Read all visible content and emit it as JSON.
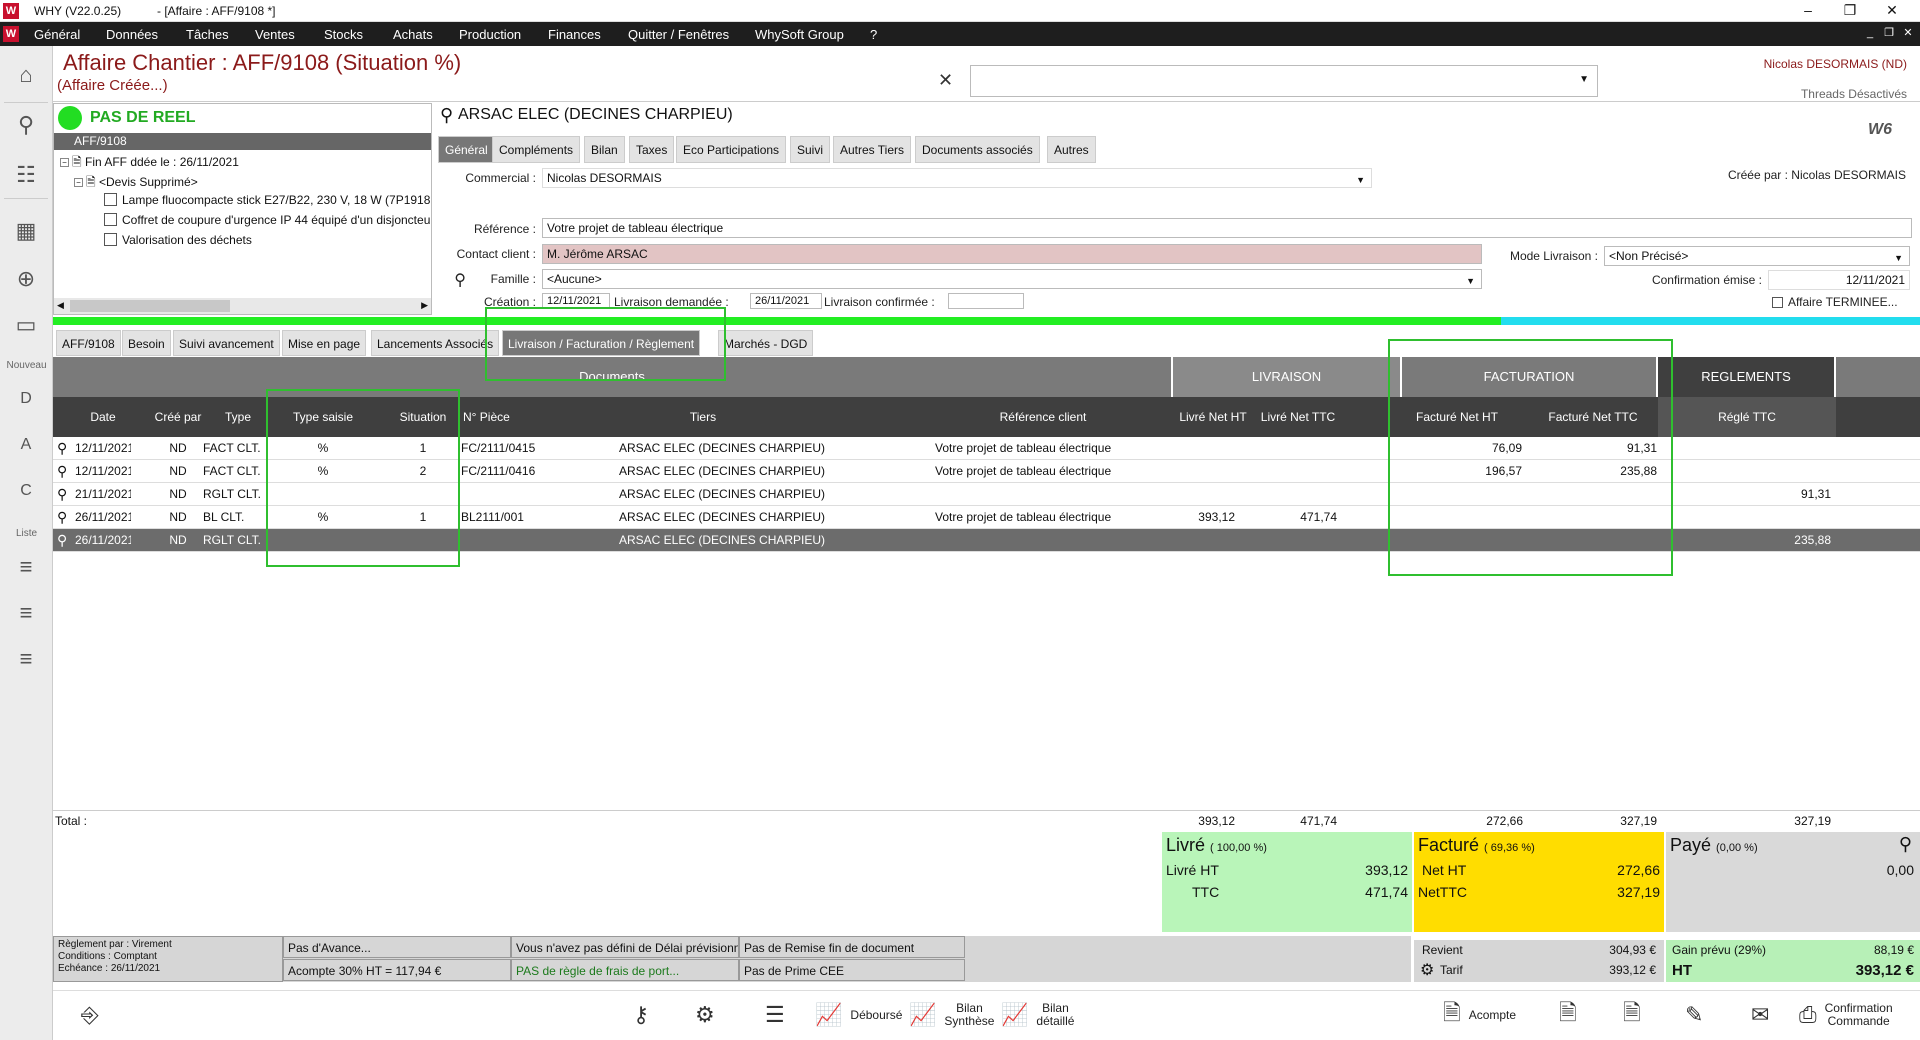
{
  "window": {
    "app_title": "WHY (V22.0.25)",
    "doc_title": "- [Affaire : AFF/9108 *]",
    "logo": "W",
    "min": "–",
    "restore": "❐",
    "close": "✕"
  },
  "menu": {
    "items": [
      "Général",
      "Données",
      "Tâches",
      "Ventes",
      "Stocks",
      "Achats",
      "Production",
      "Finances",
      "Quitter / Fenêtres",
      "WhySoft Group",
      "?"
    ],
    "mdi": [
      "_",
      "❐",
      "✕"
    ]
  },
  "leftbar": {
    "nouveau": "Nouveau",
    "liste": "Liste",
    "icons": [
      "home-icon",
      "search-icon",
      "clipboard-icon",
      "calculator-icon",
      "web-icon",
      "folder-icon",
      "new-devis-icon",
      "new-affaire-icon",
      "new-commande-icon",
      "list-d-icon",
      "list-a-icon",
      "list-c-icon"
    ],
    "glyphs": [
      "⌂",
      "⚲",
      "☷",
      "▦",
      "⊕",
      "▭",
      "D",
      "A",
      "C",
      "≡",
      "≡",
      "≡"
    ]
  },
  "header": {
    "title": "Affaire Chantier : AFF/9108 (Situation %)",
    "subtitle": "(Affaire Créée...)",
    "close": "✕",
    "user": "Nicolas DESORMAIS (ND)",
    "threads": "Threads Désactivés"
  },
  "tree": {
    "status": "PAS DE REEL",
    "root": "AFF/9108",
    "node1": "Fin AFF ddée le : 26/11/2021",
    "node2": "<Devis Supprimé>",
    "items": [
      "Lampe fluocompacte stick E27/B22, 230 V, 18 W (7P1918",
      "Coffret de coupure d'urgence IP 44 équipé d'un disjoncteu",
      "Valorisation des déchets"
    ]
  },
  "fiche": {
    "client": "ARSAC ELEC  (DECINES CHARPIEU)",
    "logo": "W6",
    "tabs": [
      "Général",
      "Compléments",
      "Bilan",
      "Taxes",
      "Eco Participations",
      "Suivi",
      "Autres Tiers",
      "Documents associés",
      "Autres"
    ],
    "commercial_label": "Commercial :",
    "commercial": "Nicolas DESORMAIS",
    "creee_par": "Créée par : Nicolas DESORMAIS",
    "reference_label": "Référence :",
    "reference": "Votre projet de tableau électrique",
    "contact_label": "Contact client :",
    "contact": "M. Jérôme ARSAC",
    "famille_label": "Famille :",
    "famille": "<Aucune>",
    "mode_label": "Mode Livraison :",
    "mode": "<Non Précisé>",
    "confirm_label": "Confirmation émise :",
    "confirm": "12/11/2021",
    "creation_label": "Création :",
    "creation": "12/11/2021",
    "livdem_label": "Livraison demandée :",
    "livdem": "26/11/2021",
    "livconf_label": "Livraison confirmée :",
    "livconf": "",
    "terminee": "Affaire TERMINEE..."
  },
  "tabs2": [
    "AFF/9108",
    "Besoin",
    "Suivi avancement",
    "Mise en page",
    "Lancements Associés",
    "Livraison / Facturation / Règlement",
    "Marchés - DGD"
  ],
  "grid": {
    "groups": {
      "documents": "Documents",
      "livraison": "LIVRAISON",
      "facturation": "FACTURATION",
      "reglements": "REGLEMENTS"
    },
    "columns": [
      "Date",
      "Créé par",
      "Type",
      "Type saisie",
      "Situation",
      "N° Pièce",
      "Tiers",
      "Référence client",
      "Livré Net HT",
      "Livré Net TTC",
      "Facturé Net HT",
      "Facturé Net TTC",
      "Réglé TTC"
    ],
    "rows": [
      [
        "12/11/2021",
        "ND",
        "FACT CLT.",
        "%",
        "1",
        "FC/2111/0415",
        "ARSAC ELEC  (DECINES CHARPIEU)",
        "Votre projet de tableau électrique",
        "",
        "",
        "76,09",
        "91,31",
        ""
      ],
      [
        "12/11/2021",
        "ND",
        "FACT CLT.",
        "%",
        "2",
        "FC/2111/0416",
        "ARSAC ELEC  (DECINES CHARPIEU)",
        "Votre projet de tableau électrique",
        "",
        "",
        "196,57",
        "235,88",
        ""
      ],
      [
        "21/11/2021",
        "ND",
        "RGLT CLT.",
        "",
        "",
        "",
        "ARSAC ELEC  (DECINES CHARPIEU)",
        "",
        "",
        "",
        "",
        "",
        "91,31"
      ],
      [
        "26/11/2021",
        "ND",
        "BL CLT.",
        "%",
        "1",
        "BL2111/001",
        "ARSAC ELEC  (DECINES CHARPIEU)",
        "Votre projet de tableau électrique",
        "393,12",
        "471,74",
        "",
        "",
        ""
      ],
      [
        "26/11/2021",
        "ND",
        "RGLT CLT.",
        "",
        "",
        "",
        "ARSAC ELEC  (DECINES CHARPIEU)",
        "",
        "",
        "",
        "",
        "",
        "235,88"
      ]
    ],
    "total_label": "Total :",
    "totals": {
      "livre_ht": "393,12",
      "livre_ttc": "471,74",
      "fact_ht": "272,66",
      "fact_ttc": "327,19",
      "regle": "327,19"
    }
  },
  "summary": {
    "livre": {
      "title": "Livré",
      "pct": "( 100,00 %)",
      "l1": "Livré HT",
      "v1": "393,12",
      "l2": "TTC",
      "v2": "471,74",
      "color": "#b9f5b9"
    },
    "facture": {
      "title": "Facturé",
      "pct": "( 69,36 %)",
      "l1": "Net HT",
      "v1": "272,66",
      "l2": "NetTTC",
      "v2": "327,19",
      "color": "#ffdd00"
    },
    "paye": {
      "title": "Payé",
      "pct": "(0,00 %)",
      "v1": "0,00",
      "color": "#d9d9d9"
    }
  },
  "bottom": {
    "reglement": "Règlement par : Virement",
    "conditions": "Conditions : Comptant",
    "echeance": "Echéance : 26/11/2021",
    "avance": "Pas d'Avance...",
    "acompte": "Acompte 30% HT = 117,94 €",
    "delai": "Vous n'avez pas défini de Délai prévisionnel",
    "frais": "PAS de règle de frais de port...",
    "remise": "Pas de Remise fin de document",
    "prime": "Pas de Prime CEE",
    "revient_label": "Revient",
    "revient": "304,93 €",
    "tarif_label": "Tarif",
    "tarif": "393,12 €",
    "gain_label": "Gain prévu (29%)",
    "gain": "88,19 €",
    "ht_label": "HT",
    "ht": "393,12 €"
  },
  "toolbar": {
    "debourse": "Déboursé",
    "bilan_synthese": "Bilan\nSynthèse",
    "bilan_detaille": "Bilan\ndétaillé",
    "acompte": "Acompte",
    "confirmation": "Confirmation\nCommande"
  }
}
